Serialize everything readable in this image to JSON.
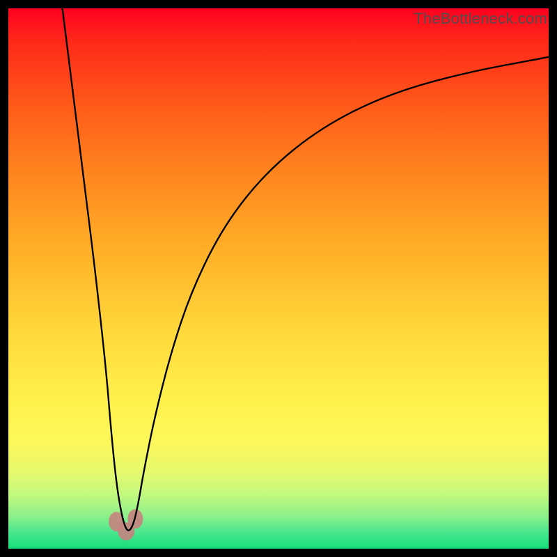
{
  "watermark": "TheBottleneck.com",
  "colors": {
    "frame": "#000000",
    "gradient_top": "#ff0020",
    "gradient_mid": "#ffd93c",
    "gradient_bottom": "#16e07a",
    "curve": "#000000",
    "blob": "#c98080"
  },
  "chart_data": {
    "type": "line",
    "title": "",
    "xlabel": "",
    "ylabel": "",
    "xlim": [
      0,
      100
    ],
    "ylim": [
      0,
      100
    ],
    "note": "Values are percentages of plot area; y=0 is bottom (green). Curve is a steep V whose minimum sits near x≈22 with the right branch rising asymptotically.",
    "series": [
      {
        "name": "bottleneck-curve",
        "x": [
          10,
          12,
          14,
          16,
          18,
          19,
          20,
          21,
          22,
          23,
          24,
          25,
          27,
          30,
          34,
          40,
          48,
          58,
          70,
          84,
          100
        ],
        "y": [
          100,
          84,
          68,
          52,
          34,
          22,
          12,
          6,
          3,
          4,
          8,
          14,
          24,
          36,
          48,
          60,
          70,
          78,
          84,
          88,
          91
        ]
      }
    ],
    "markers": [
      {
        "name": "min-blob-left",
        "x": 20.0,
        "y": 5.0
      },
      {
        "name": "min-blob-right",
        "x": 23.5,
        "y": 5.5
      },
      {
        "name": "min-blob-center",
        "x": 21.8,
        "y": 3.2
      }
    ]
  }
}
